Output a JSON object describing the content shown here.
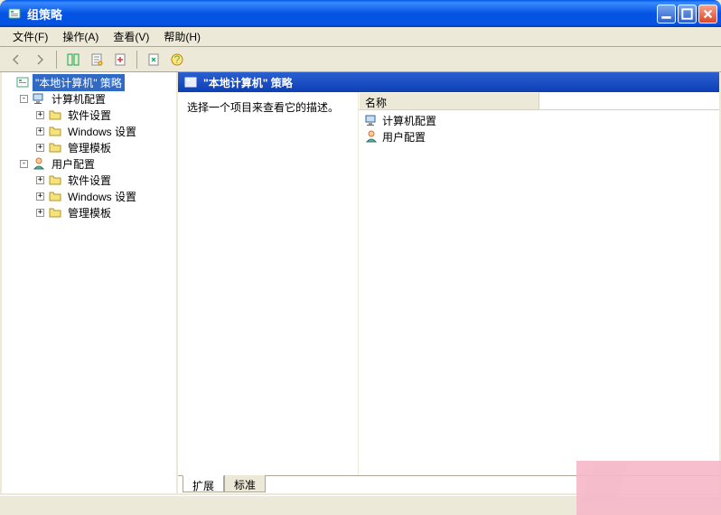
{
  "window": {
    "title": "组策略"
  },
  "menu": {
    "file": "文件(F)",
    "action": "操作(A)",
    "view": "查看(V)",
    "help": "帮助(H)"
  },
  "tree": {
    "root": "\"本地计算机\" 策略",
    "computer": "计算机配置",
    "user": "用户配置",
    "software": "软件设置",
    "windows": "Windows 设置",
    "templates": "管理模板"
  },
  "header": {
    "title": "\"本地计算机\" 策略"
  },
  "description": "选择一个项目来查看它的描述。",
  "list": {
    "col_name": "名称",
    "items": {
      "computer": "计算机配置",
      "user": "用户配置"
    }
  },
  "tabs": {
    "extended": "扩展",
    "standard": "标准"
  }
}
